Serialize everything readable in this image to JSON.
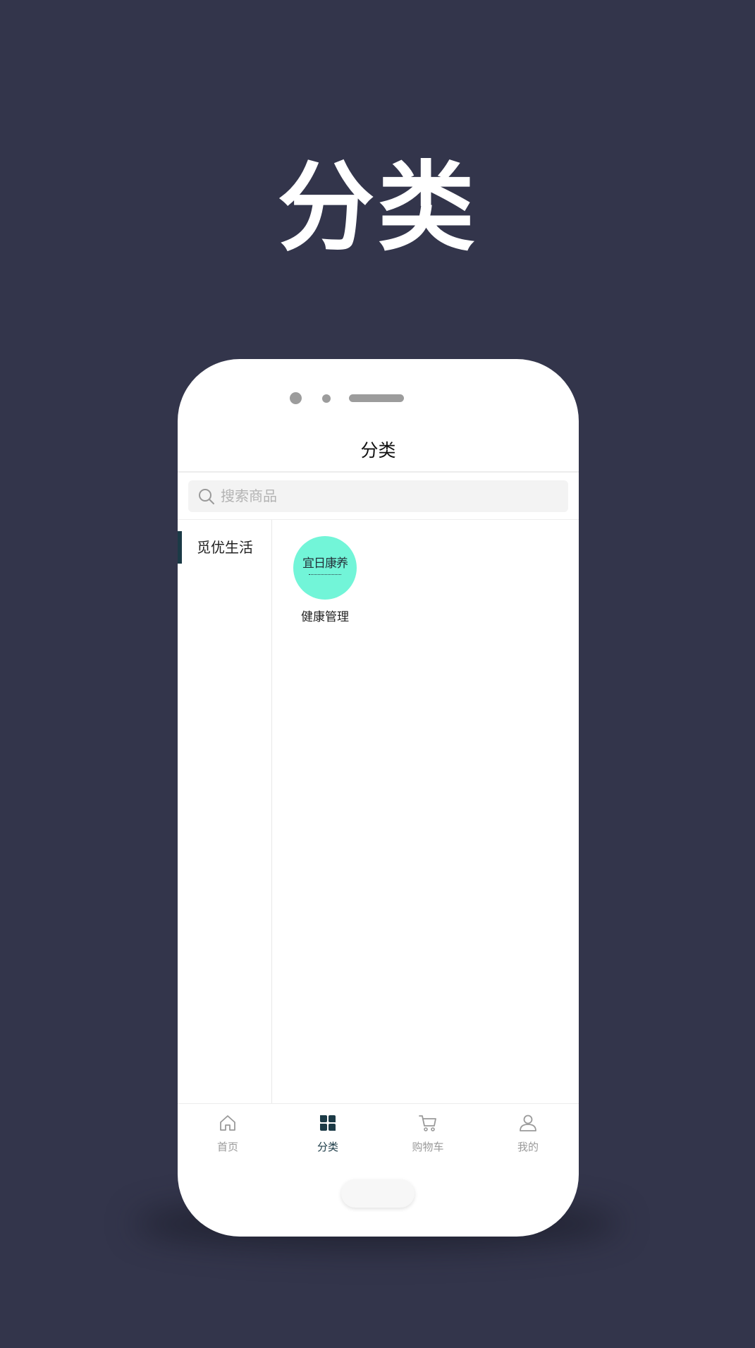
{
  "headline": "分类",
  "screen": {
    "title": "分类"
  },
  "search": {
    "placeholder": "搜索商品"
  },
  "sidebar": {
    "items": [
      {
        "label": "觅优生活",
        "active": true
      }
    ]
  },
  "categories": [
    {
      "name": "健康管理",
      "logo_text": "宜日康养",
      "logo_color": "#72f5d8"
    }
  ],
  "tabbar": {
    "tabs": [
      {
        "label": "首页",
        "icon": "home-icon",
        "active": false
      },
      {
        "label": "分类",
        "icon": "category-grid-icon",
        "active": true
      },
      {
        "label": "购物车",
        "icon": "cart-icon",
        "active": false
      },
      {
        "label": "我的",
        "icon": "user-icon",
        "active": false
      }
    ]
  },
  "colors": {
    "background": "#33354b",
    "accent": "#1b3a46",
    "inactive": "#9a9a9a"
  }
}
